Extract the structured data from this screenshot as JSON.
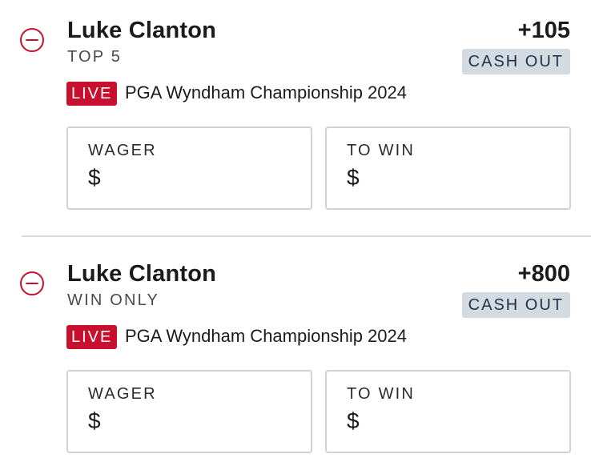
{
  "bets": [
    {
      "player": "Luke Clanton",
      "bet_type": "TOP 5",
      "odds": "+105",
      "cash_out_label": "CASH OUT",
      "live_label": "LIVE",
      "event": "PGA Wyndham Championship 2024",
      "wager": {
        "label": "WAGER",
        "currency": "$"
      },
      "to_win": {
        "label": "TO WIN",
        "currency": "$"
      }
    },
    {
      "player": "Luke Clanton",
      "bet_type": "WIN ONLY",
      "odds": "+800",
      "cash_out_label": "CASH OUT",
      "live_label": "LIVE",
      "event": "PGA Wyndham Championship 2024",
      "wager": {
        "label": "WAGER",
        "currency": "$"
      },
      "to_win": {
        "label": "TO WIN",
        "currency": "$"
      }
    }
  ],
  "colors": {
    "remove_icon": "#c8102e",
    "live_badge": "#c8102e",
    "cash_out_badge_bg": "#d3dae1",
    "cash_out_badge_text": "#1f3347",
    "input_border": "#d2d2d2",
    "divider": "#d9d9d9"
  },
  "icons": {
    "remove": "minus-circle-icon"
  }
}
